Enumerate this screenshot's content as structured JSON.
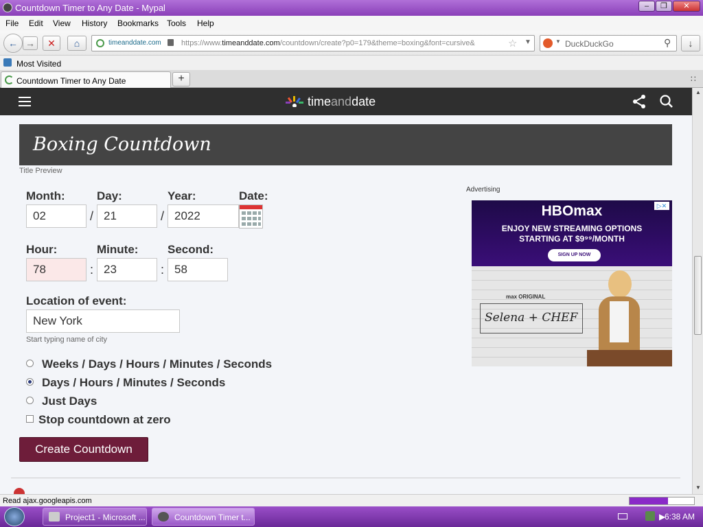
{
  "window": {
    "title": "Countdown Timer to Any Date - Mypal"
  },
  "menu": [
    "File",
    "Edit",
    "View",
    "History",
    "Bookmarks",
    "Tools",
    "Help"
  ],
  "nav": {
    "site_identity": "timeanddate.com",
    "url_prefix": "https://www.",
    "url_host": "timeanddate.com",
    "url_path": "/countdown/create?p0=179&theme=boxing&font=cursive&",
    "search_placeholder": "DuckDuckGo"
  },
  "bookmarks": {
    "most_visited": "Most Visited"
  },
  "tabs": [
    {
      "label": "Countdown Timer to Any Date"
    }
  ],
  "site": {
    "logo_prefix": "time",
    "logo_mid": "and",
    "logo_suffix": "date"
  },
  "preview": {
    "title": "Boxing Countdown",
    "caption": "Title Preview"
  },
  "form": {
    "month_label": "Month:",
    "day_label": "Day:",
    "year_label": "Year:",
    "date_label": "Date:",
    "month": "02",
    "day": "21",
    "year": "2022",
    "date_sep": "/",
    "hour_label": "Hour:",
    "minute_label": "Minute:",
    "second_label": "Second:",
    "hour": "78",
    "minute": "23",
    "second": "58",
    "time_sep": ":",
    "location_label": "Location of event:",
    "location": "New York",
    "location_hint": "Start typing name of city",
    "options": [
      {
        "label": "Weeks / Days / Hours / Minutes / Seconds",
        "selected": false
      },
      {
        "label": "Days / Hours / Minutes / Seconds",
        "selected": true
      },
      {
        "label": "Just Days",
        "selected": false
      }
    ],
    "stop_label": "Stop countdown at zero",
    "stop_checked": false,
    "submit": "Create Countdown"
  },
  "ad": {
    "label": "Advertising",
    "brand": "HBOmax",
    "headline": "ENJOY NEW STREAMING OPTIONS",
    "subline": "STARTING AT $9⁹⁹/MONTH",
    "cta": "SIGN UP NOW",
    "show_tag": "max ORIGINAL",
    "show_name": "Selena + CHEF",
    "brand_color": "#2a0a5a"
  },
  "status": {
    "text": "Read ajax.googleapis.com",
    "progress": 0.6
  },
  "taskbar": {
    "tasks": [
      {
        "label": "Project1 - Microsoft ..."
      },
      {
        "label": "Countdown Timer t..."
      }
    ],
    "clock": "6:38 AM"
  }
}
